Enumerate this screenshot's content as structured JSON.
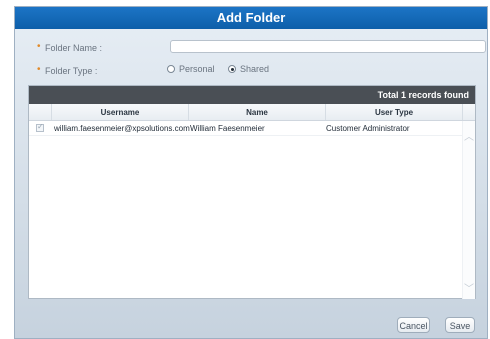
{
  "dialog": {
    "title": "Add Folder"
  },
  "form": {
    "folder_name_label": "Folder Name :",
    "folder_name_value": "",
    "folder_type_label": "Folder Type :",
    "folder_type_options": [
      {
        "label": "Personal",
        "selected": false
      },
      {
        "label": "Shared",
        "selected": true
      }
    ],
    "required_marker": "•"
  },
  "grid": {
    "summary": "Total 1 records found",
    "columns": [
      "Username",
      "Name",
      "User Type"
    ],
    "rows": [
      {
        "checked": true,
        "username": "william.faesenmeier@xpsolutions.com",
        "name": "William Faesenmeier",
        "user_type": "Customer Administrator"
      }
    ]
  },
  "buttons": {
    "cancel": "Cancel",
    "save": "Save"
  },
  "icons": {
    "scroll_up": "chevron-up-icon",
    "scroll_down": "chevron-down-icon",
    "checkbox": "checkbox-icon"
  },
  "colors": {
    "titlebar": "#1c74c6",
    "grid_top": "#4a4f55",
    "required": "#e18a2a"
  }
}
